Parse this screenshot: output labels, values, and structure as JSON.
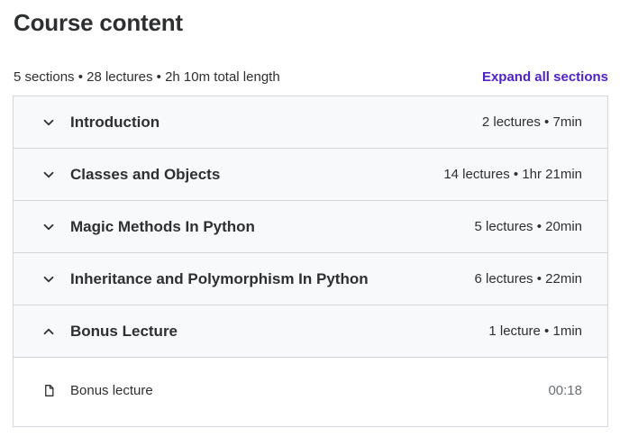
{
  "header": {
    "title": "Course content",
    "summary": "5 sections • 28 lectures • 2h 10m total length",
    "expand_all_label": "Expand all sections"
  },
  "sections": [
    {
      "title": "Introduction",
      "info": "2 lectures • 7min",
      "expanded": false,
      "icon": "chevron-down-icon"
    },
    {
      "title": "Classes and Objects",
      "info": "14 lectures • 1hr 21min",
      "expanded": false,
      "icon": "chevron-down-icon"
    },
    {
      "title": "Magic Methods In Python",
      "info": "5 lectures • 20min",
      "expanded": false,
      "icon": "chevron-down-icon"
    },
    {
      "title": "Inheritance and Polymorphism In Python",
      "info": "6 lectures • 22min",
      "expanded": false,
      "icon": "chevron-down-icon"
    },
    {
      "title": "Bonus Lecture",
      "info": "1 lecture • 1min",
      "expanded": true,
      "icon": "chevron-up-icon",
      "lectures": [
        {
          "title": "Bonus lecture",
          "duration": "00:18",
          "icon": "file-icon"
        }
      ]
    }
  ],
  "colors": {
    "accent": "#5022c3",
    "text": "#2d2f31",
    "muted": "#6a6f73",
    "header_bg": "#f7f9fa",
    "border": "#d1d7dc"
  }
}
